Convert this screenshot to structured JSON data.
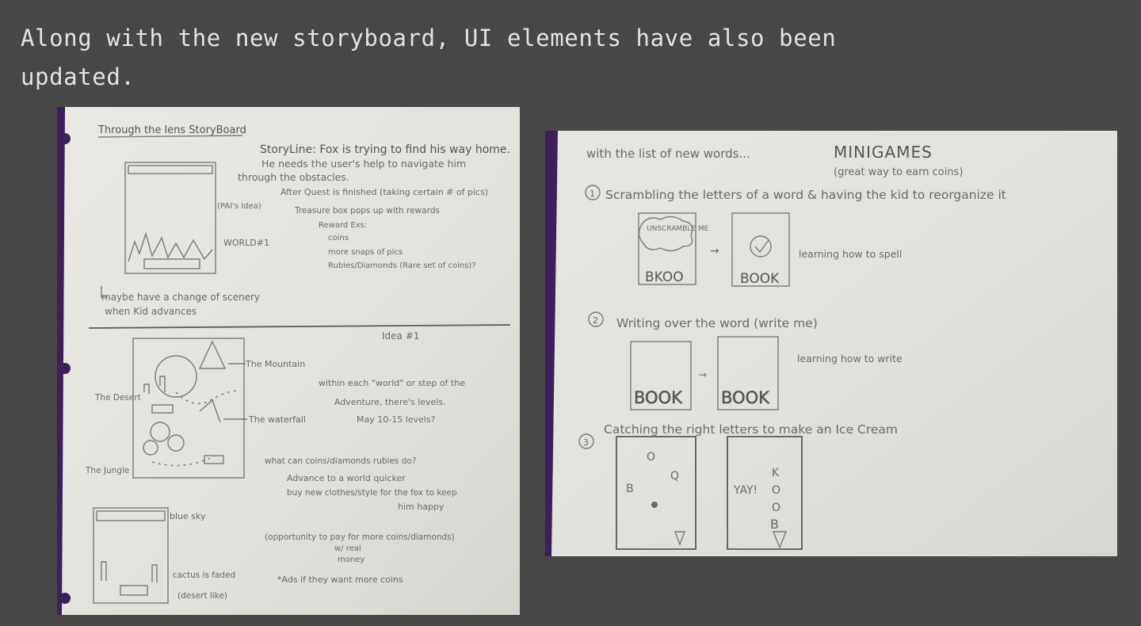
{
  "caption": {
    "line1": "Along with the new storyboard, UI elements have also been",
    "line2": "updated."
  },
  "left_sketch": {
    "title": "Through the lens StoryBoard",
    "storyline_1": "StoryLine: Fox is trying to find his way home.",
    "storyline_2": "He needs the user's help to navigate him",
    "storyline_3": "through the obstacles.",
    "after_quest": "After Quest is finished (taking certain # of pics)",
    "treasure": "Treasure box pops up with rewards",
    "reward_ex": "Reward Exs:",
    "reward_coins": "coins",
    "reward_snaps": "more snaps of pics",
    "reward_rubies": "Rubies/Diamonds (Rare set of coins)?",
    "pai_idea": "(PAI's Idea)",
    "world1": "WORLD#1",
    "scenery_1": "maybe have a change of scenery",
    "scenery_2": "when Kid advances",
    "idea1": "Idea #1",
    "mountain": "The Mountain",
    "waterfall": "The waterfall",
    "desert": "The Desert",
    "jungle": "The Jungle",
    "levels_1": "within each \"world\" or step of the",
    "levels_2": "Adventure, there's levels.",
    "levels_3": "May 10-15 levels?",
    "coins_q": "what can coins/diamonds rubies do?",
    "advance": "Advance to a world quicker",
    "clothes_1": "buy new clothes/style for the fox to keep",
    "clothes_2": "him happy",
    "pay_1": "(opportunity to pay for more coins/diamonds)",
    "pay_2": "w/ real",
    "pay_3": "money",
    "ads": "*Ads if they want more coins",
    "blue_sky": "blue sky",
    "cactus": "cactus is faded",
    "desert_like": "(desert like)"
  },
  "right_sketch": {
    "header": "with the list of new words...",
    "minigames": "MINIGAMES",
    "earn": "(great way to earn coins)",
    "step1": "Scrambling the letters of a word & having the kid to reorganize it",
    "unscramble": "UNSCRAMBLE ME",
    "scrambled": "BKOO",
    "book1": "BOOK",
    "spell": "learning how to spell",
    "step2": "Writing over the word (write me)",
    "write": "learning how to write",
    "book2a": "BOOK",
    "book2b": "BOOK",
    "step3": "Catching the right letters to make an Ice Cream",
    "letter_o": "O",
    "letter_q": "Q",
    "letter_b": "B",
    "yay": "YAY!",
    "stack_k": "K",
    "stack_o1": "O",
    "stack_o2": "O",
    "stack_b": "B",
    "num1": "1",
    "num2": "2",
    "num3": "3"
  }
}
